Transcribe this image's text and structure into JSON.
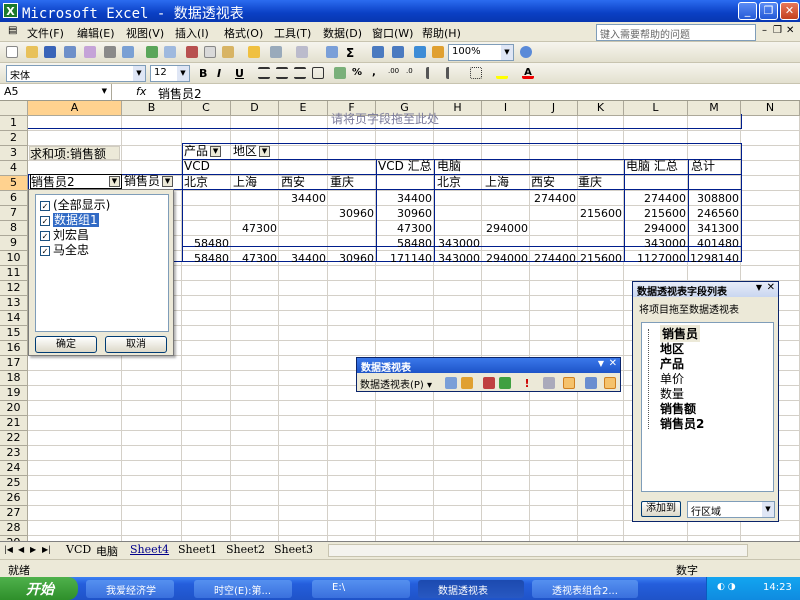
{
  "window": {
    "title": "Microsoft Excel - 数据透视表",
    "min": "_",
    "restore": "❐",
    "close": "✕"
  },
  "menu": {
    "items": [
      "文件(F)",
      "编辑(E)",
      "视图(V)",
      "插入(I)",
      "格式(O)",
      "工具(T)",
      "数据(D)",
      "窗口(W)",
      "帮助(H)"
    ],
    "help_placeholder": "键入需要帮助的问题"
  },
  "toolbar": {
    "zoom": "100%",
    "font": "宋体",
    "size": "12",
    "bold": "B",
    "italic": "I",
    "underline": "U"
  },
  "formula": {
    "namebox": "A5",
    "fx": "fx",
    "content": "销售员2"
  },
  "columns": [
    "A",
    "B",
    "C",
    "D",
    "E",
    "F",
    "G",
    "H",
    "I",
    "J",
    "K",
    "L",
    "M",
    "N"
  ],
  "rows": [
    "1",
    "2",
    "3",
    "4",
    "5",
    "6",
    "7",
    "8",
    "9",
    "10",
    "11",
    "12",
    "13",
    "14",
    "15",
    "16",
    "17",
    "18",
    "19",
    "20",
    "21",
    "22",
    "23",
    "24",
    "25",
    "26",
    "27",
    "28",
    "29"
  ],
  "pivot": {
    "drop_page_hint": "请将页字段拖至此处",
    "data_label": "求和项:销售额",
    "col_field1": "产品",
    "col_field2": "地区",
    "row_field1": "销售员2",
    "row_field2": "销售员",
    "group_vcd": "VCD",
    "vcd_total": "VCD 汇总",
    "group_pc": "电脑",
    "pc_total": "电脑 汇总",
    "grand_total": "总计",
    "regions": [
      "北京",
      "上海",
      "西安",
      "重庆"
    ],
    "regions2": [
      "北京",
      "上海",
      "西安",
      "重庆"
    ],
    "r6": {
      "e": "34400",
      "g": "34400",
      "j": "274400",
      "l": "274400",
      "m": "308800"
    },
    "r7": {
      "f": "30960",
      "g": "30960",
      "k": "215600",
      "l": "215600",
      "m": "246560"
    },
    "r8": {
      "d": "47300",
      "g": "47300",
      "i": "294000",
      "l": "294000",
      "m": "341300"
    },
    "r9": {
      "c": "58480",
      "g": "58480",
      "h": "343000",
      "l": "343000",
      "m": "401480"
    },
    "r10": {
      "c": "58480",
      "d": "47300",
      "e": "34400",
      "f": "30960",
      "g": "171140",
      "h": "343000",
      "i": "294000",
      "j": "274400",
      "k": "215600",
      "l": "1127000",
      "m": "1298140"
    }
  },
  "dropdown": {
    "items": [
      "(全部显示)",
      "数据组1",
      "刘宏昌",
      "马全忠"
    ],
    "ok": "确定",
    "cancel": "取消"
  },
  "pivot_toolbar": {
    "title": "数据透视表",
    "menu": "数据透视表(P)"
  },
  "field_list": {
    "title": "数据透视表字段列表",
    "hint": "将项目拖至数据透视表",
    "fields": [
      "销售员",
      "地区",
      "产品",
      "单价",
      "数量",
      "销售额",
      "销售员2"
    ],
    "add_button": "添加到",
    "area": "行区域"
  },
  "sheets": [
    "VCD",
    "电脑",
    "Sheet4",
    "Sheet1",
    "Sheet2",
    "Sheet3"
  ],
  "status": {
    "left": "就绪",
    "right": "数字"
  },
  "taskbar": {
    "start": "开始",
    "tasks": [
      "我爱经济学",
      "时空(E):第...",
      "E:\\",
      "数据透视表",
      "透视表组合2..."
    ],
    "clock": "14:23"
  }
}
